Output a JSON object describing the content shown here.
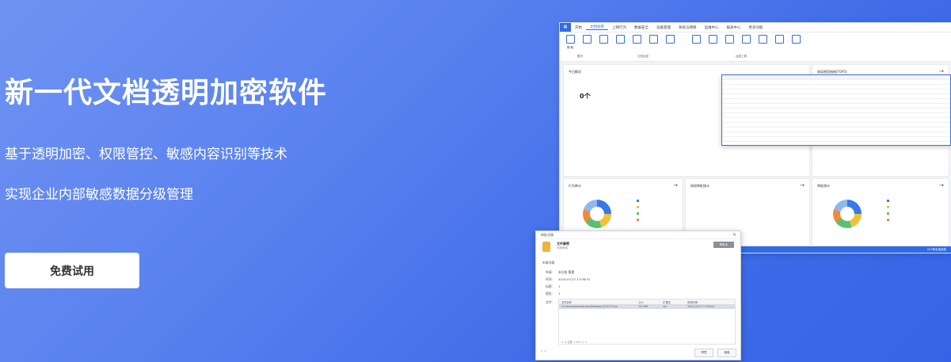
{
  "hero": {
    "title": "新一代文档透明加密软件",
    "subtitle1": "基于透明加密、权限管控、敏感内容识别等技术",
    "subtitle2": "实现企业内部敏感数据分级管理",
    "cta_label": "免费试用"
  },
  "app": {
    "menu": [
      "开始",
      "文档加密",
      "上网行为",
      "数据安全",
      "设备管理",
      "系统与网络",
      "运维中心",
      "报表中心",
      "更多功能"
    ],
    "ribbon_groups": [
      "概况",
      "文档加密",
      "运维工具"
    ],
    "ribbon_tools": [
      "概 略"
    ],
    "overview_title": "今日概况",
    "overview_value": "0个",
    "panels": [
      "行为审计",
      "授权审批统计",
      "审批统计"
    ],
    "status_text": "247条未读消息",
    "top_panel_title": "阅读使用指南(TOP5)"
  },
  "dialog": {
    "window_title": "审批详情",
    "title": "文件解密",
    "subtitle": "待我审批",
    "status": "审批中",
    "section": "申请详情",
    "fields": [
      {
        "label": "申请：",
        "value": "未分组 管理"
      },
      {
        "label": "时间：",
        "value": "2024-03-27 17:06:51"
      },
      {
        "label": "标题：",
        "value": "1"
      },
      {
        "label": "理由：",
        "value": "1"
      },
      {
        "label": "文件：",
        "value": ""
      }
    ],
    "table_head": [
      "文件名称",
      "大小",
      "扩展名",
      "修改时间"
    ],
    "table_row": [
      "C:\\Users\\Administrator\\Desktop\\1231233.xls",
      "26.7KB",
      "xls",
      "2024-03-27 17:05:04"
    ],
    "pager": "< < 记录: 1 of 1 > >",
    "buttons": [
      "同意",
      "拒绝"
    ]
  },
  "colors": {
    "accent": "#2f6be6",
    "bg_start": "#6f93f3",
    "bg_end": "#3565e6"
  }
}
